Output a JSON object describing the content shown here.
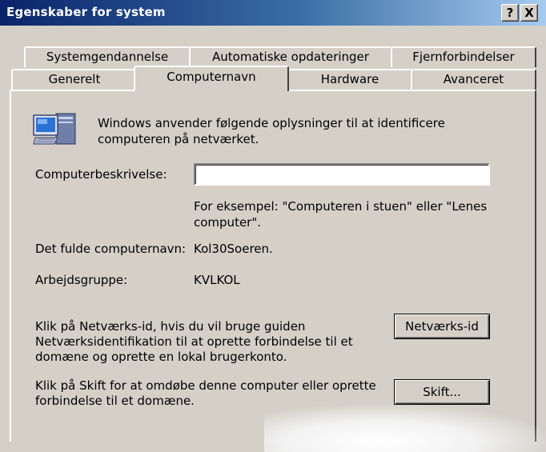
{
  "window": {
    "title": "Egenskaber for system",
    "help_button": "?",
    "close_button": "X"
  },
  "tabs_row1": [
    {
      "label": "Systemgendannelse"
    },
    {
      "label": "Automatiske opdateringer"
    },
    {
      "label": "Fjernforbindelser"
    }
  ],
  "tabs_row2": [
    {
      "label": "Generelt"
    },
    {
      "label": "Computernavn",
      "active": true
    },
    {
      "label": "Hardware"
    },
    {
      "label": "Avanceret"
    }
  ],
  "intro": "Windows anvender følgende oplysninger til at identificere computeren på netværket.",
  "intro_lines": [
    "Windows anvender følgende oplysninger til at identificere",
    "computeren på netværket."
  ],
  "description": {
    "label": "Computerbeskrivelse:",
    "value": "",
    "example_lines": [
      "For eksempel: \"Computeren i stuen\" eller \"Lenes",
      "computer\"."
    ]
  },
  "full_name": {
    "label": "Det fulde computernavn:",
    "value": "Kol30Soeren."
  },
  "workgroup": {
    "label": "Arbejdsgruppe:",
    "value": "KVLKOL"
  },
  "network_id": {
    "text_lines": [
      "Klik på Netværks-id, hvis du vil bruge guiden",
      "Netværksidentifikation til at oprette forbindelse til et",
      "domæne og oprette en lokal brugerkonto."
    ],
    "button": "Netværks-id"
  },
  "change": {
    "text_lines": [
      "Klik på Skift for at omdøbe denne computer eller oprette",
      "forbindelse til et domæne."
    ],
    "button": "Skift..."
  },
  "icons": {
    "computer": "computer-icon",
    "help": "help-icon",
    "close": "close-icon"
  }
}
